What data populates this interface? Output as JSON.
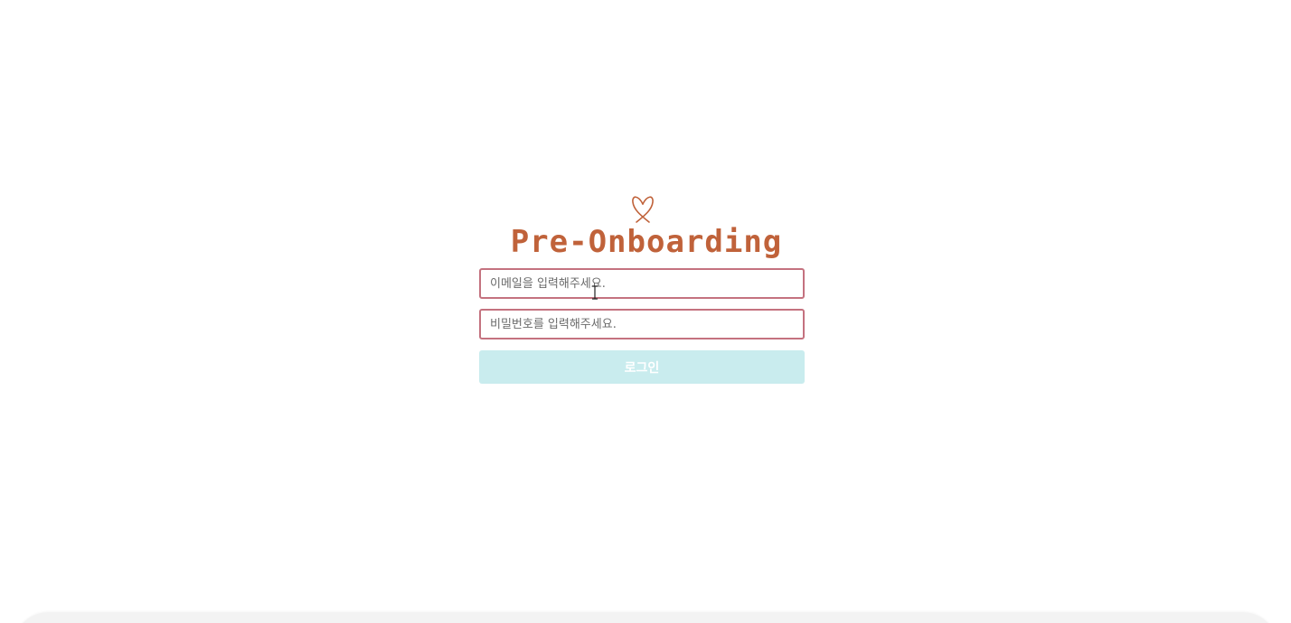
{
  "app": {
    "logo_text": "Pre-Onboarding",
    "logo_icon": "heart-ribbon-icon",
    "brand_color": "#c0623a"
  },
  "form": {
    "email_placeholder": "이메일을 입력해주세요.",
    "password_placeholder": "비밀번호를 입력해주세요.",
    "login_label": "로그인",
    "input_border_color": "#c4727f",
    "button_color": "#c9ecee"
  }
}
